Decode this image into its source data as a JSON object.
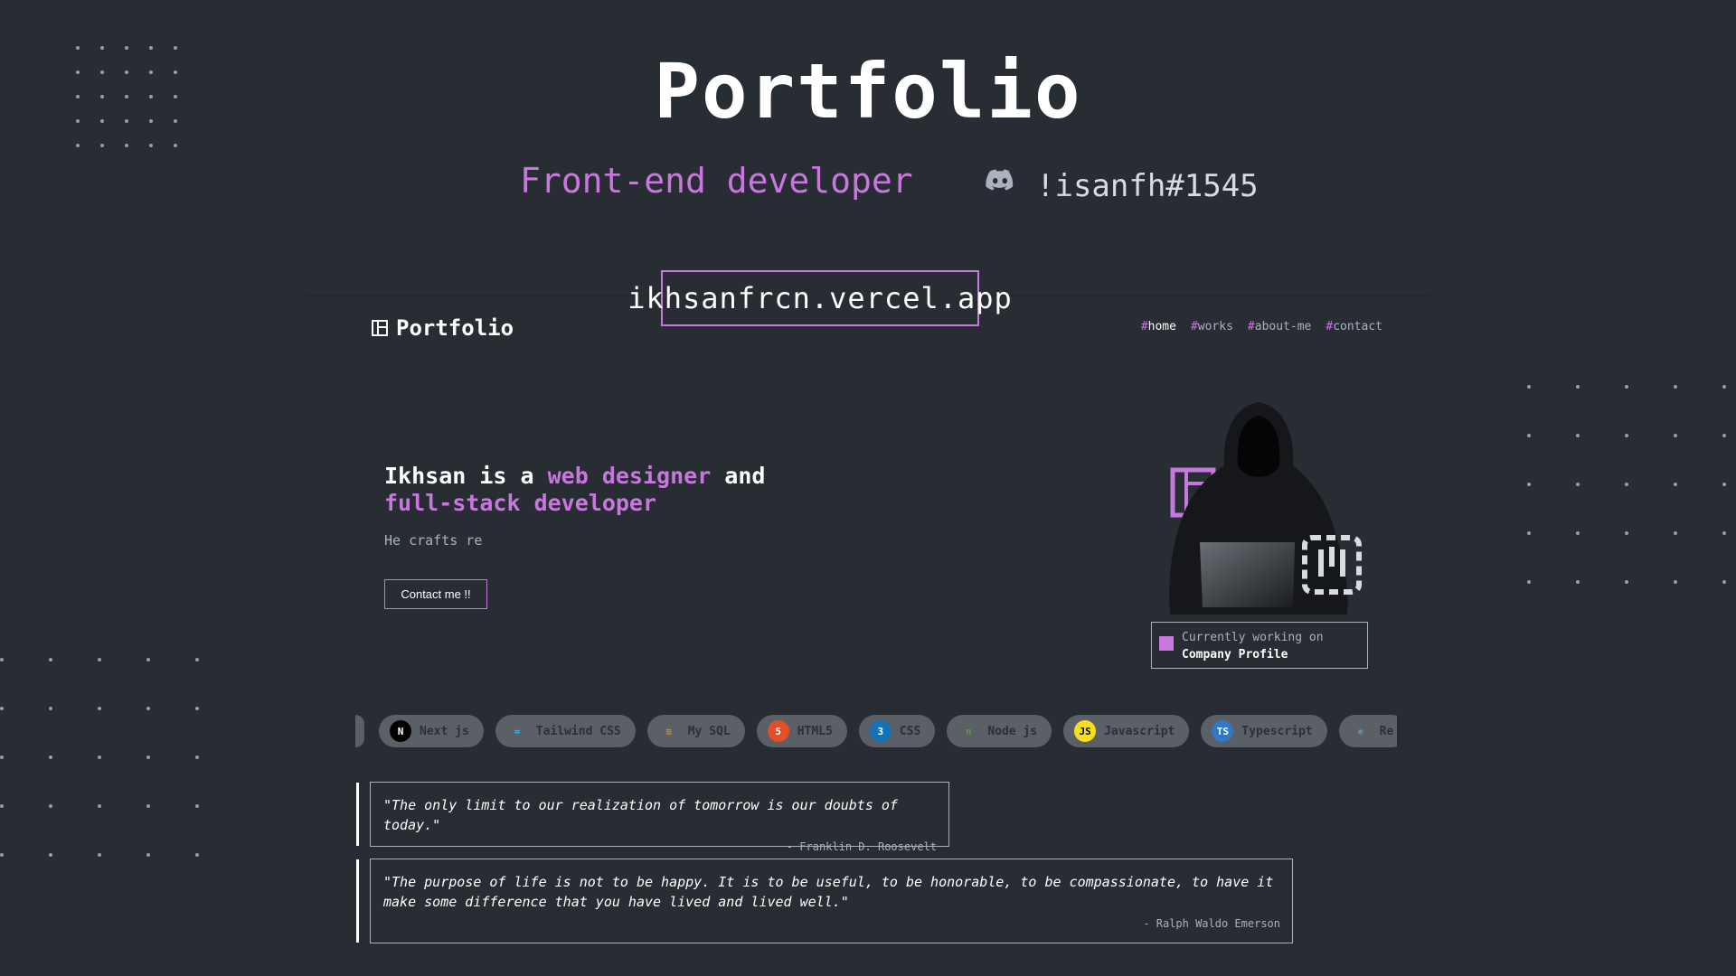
{
  "header": {
    "title": "Portfolio",
    "role": "Front-end developer",
    "discord_tag": "!isanfh#1545",
    "discord_icon": "discord-icon"
  },
  "url": "ikhsanfrcn.vercel.app",
  "site": {
    "brand": "Portfolio",
    "brand_icon": "layout-icon",
    "nav": [
      {
        "hash": "#",
        "label": "home",
        "active": true
      },
      {
        "hash": "#",
        "label": "works",
        "active": false
      },
      {
        "hash": "#",
        "label": "about-me",
        "active": false
      },
      {
        "hash": "#",
        "label": "contact",
        "active": false
      }
    ],
    "hero": {
      "line_a": "Ikhsan is a ",
      "accent_a": "web designer",
      "line_b": " and",
      "accent_b": "full-stack developer",
      "subtitle": "He crafts re",
      "contact_button": "Contact me !!"
    },
    "status": {
      "label": "Currently working on",
      "value": "Company Profile"
    },
    "skills": [
      {
        "label": "Next js",
        "icon": "N",
        "icon_name": "nextjs-icon",
        "icon_bg": "#000000",
        "icon_fg": "#ffffff"
      },
      {
        "label": "Tailwind CSS",
        "icon": "≈",
        "icon_name": "tailwind-icon",
        "icon_bg": "transparent",
        "icon_fg": "#38bdf8"
      },
      {
        "label": "My SQL",
        "icon": "≋",
        "icon_name": "mysql-icon",
        "icon_bg": "transparent",
        "icon_fg": "#e48e00"
      },
      {
        "label": "HTML5",
        "icon": "5",
        "icon_name": "html5-icon",
        "icon_bg": "#e34f26",
        "icon_fg": "#ffffff"
      },
      {
        "label": "CSS",
        "icon": "3",
        "icon_name": "css3-icon",
        "icon_bg": "#1572b6",
        "icon_fg": "#ffffff"
      },
      {
        "label": "Node js",
        "icon": "n",
        "icon_name": "nodejs-icon",
        "icon_bg": "transparent",
        "icon_fg": "#539e43"
      },
      {
        "label": "Javascript",
        "icon": "JS",
        "icon_name": "javascript-icon",
        "icon_bg": "#f7df1e",
        "icon_fg": "#000000"
      },
      {
        "label": "Typescript",
        "icon": "TS",
        "icon_name": "typescript-icon",
        "icon_bg": "#3178c6",
        "icon_fg": "#ffffff"
      },
      {
        "label": "Re",
        "icon": "⚛",
        "icon_name": "react-icon",
        "icon_bg": "transparent",
        "icon_fg": "#61dafb"
      }
    ],
    "quotes": [
      {
        "text": "\"The only limit to our realization of tomorrow is our doubts of today.\"",
        "author": "- Franklin D. Roosevelt"
      },
      {
        "text": "\"The purpose of life is not to be happy. It is to be useful, to be honorable, to be compassionate, to have it make some difference that you have lived and lived well.\"",
        "author": "- Ralph Waldo Emerson"
      }
    ]
  },
  "colors": {
    "background": "#282c33",
    "accent": "#c778dd",
    "muted": "#abb2bf",
    "chip": "#5b5f66"
  }
}
